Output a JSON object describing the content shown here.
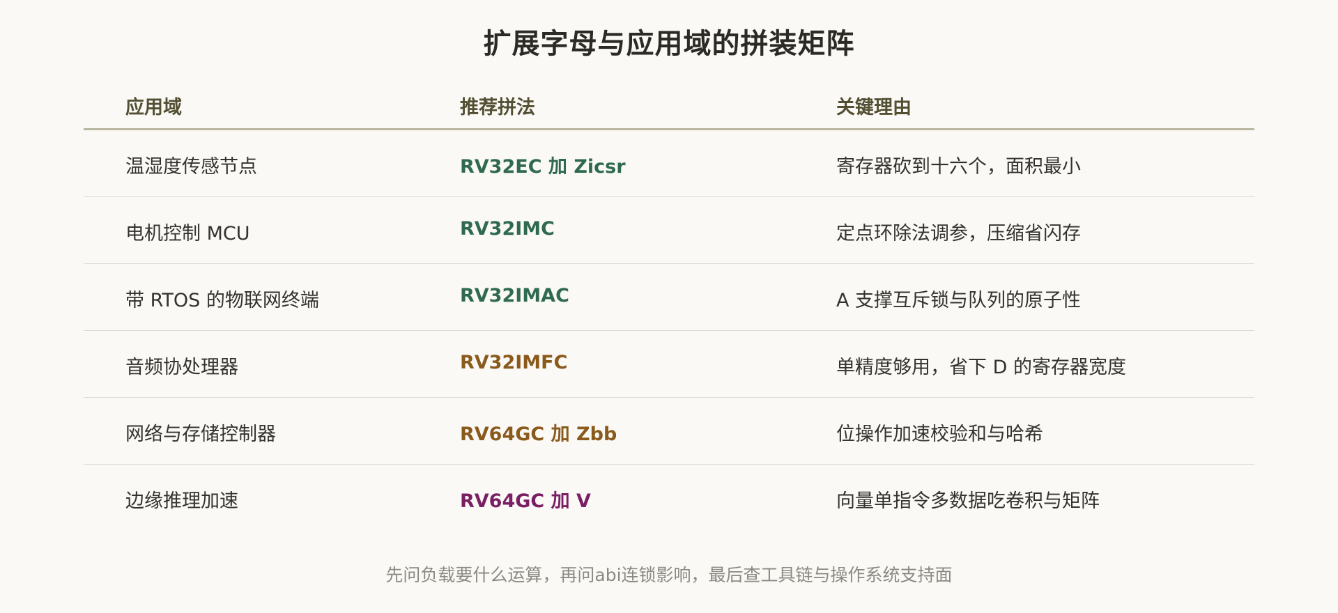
{
  "title": "扩展字母与应用域的拼装矩阵",
  "columns": [
    "应用域",
    "推荐拼法",
    "关键理由"
  ],
  "rows": [
    {
      "domain": "温湿度传感节点",
      "spell": "RV32EC 加 Zicsr",
      "reason": "寄存器砍到十六个，面积最小",
      "color": "#2f6a4f"
    },
    {
      "domain": "电机控制 MCU",
      "spell": "RV32IMC",
      "reason": "定点环除法调参，压缩省闪存",
      "color": "#2f6a4f"
    },
    {
      "domain": "带 RTOS 的物联网终端",
      "spell": "RV32IMAC",
      "reason": "A 支撑互斥锁与队列的原子性",
      "color": "#2f6a4f"
    },
    {
      "domain": "音频协处理器",
      "spell": "RV32IMFC",
      "reason": "单精度够用，省下 D 的寄存器宽度",
      "color": "#8a5a1c"
    },
    {
      "domain": "网络与存储控制器",
      "spell": "RV64GC 加 Zbb",
      "reason": "位操作加速校验和与哈希",
      "color": "#8a5a1c"
    },
    {
      "domain": "边缘推理加速",
      "spell": "RV64GC 加 V",
      "reason": "向量单指令多数据吃卷积与矩阵",
      "color": "#7a1f63"
    }
  ],
  "footer": "先问负载要什么运算，再问abi连锁影响，最后查工具链与操作系统支持面"
}
